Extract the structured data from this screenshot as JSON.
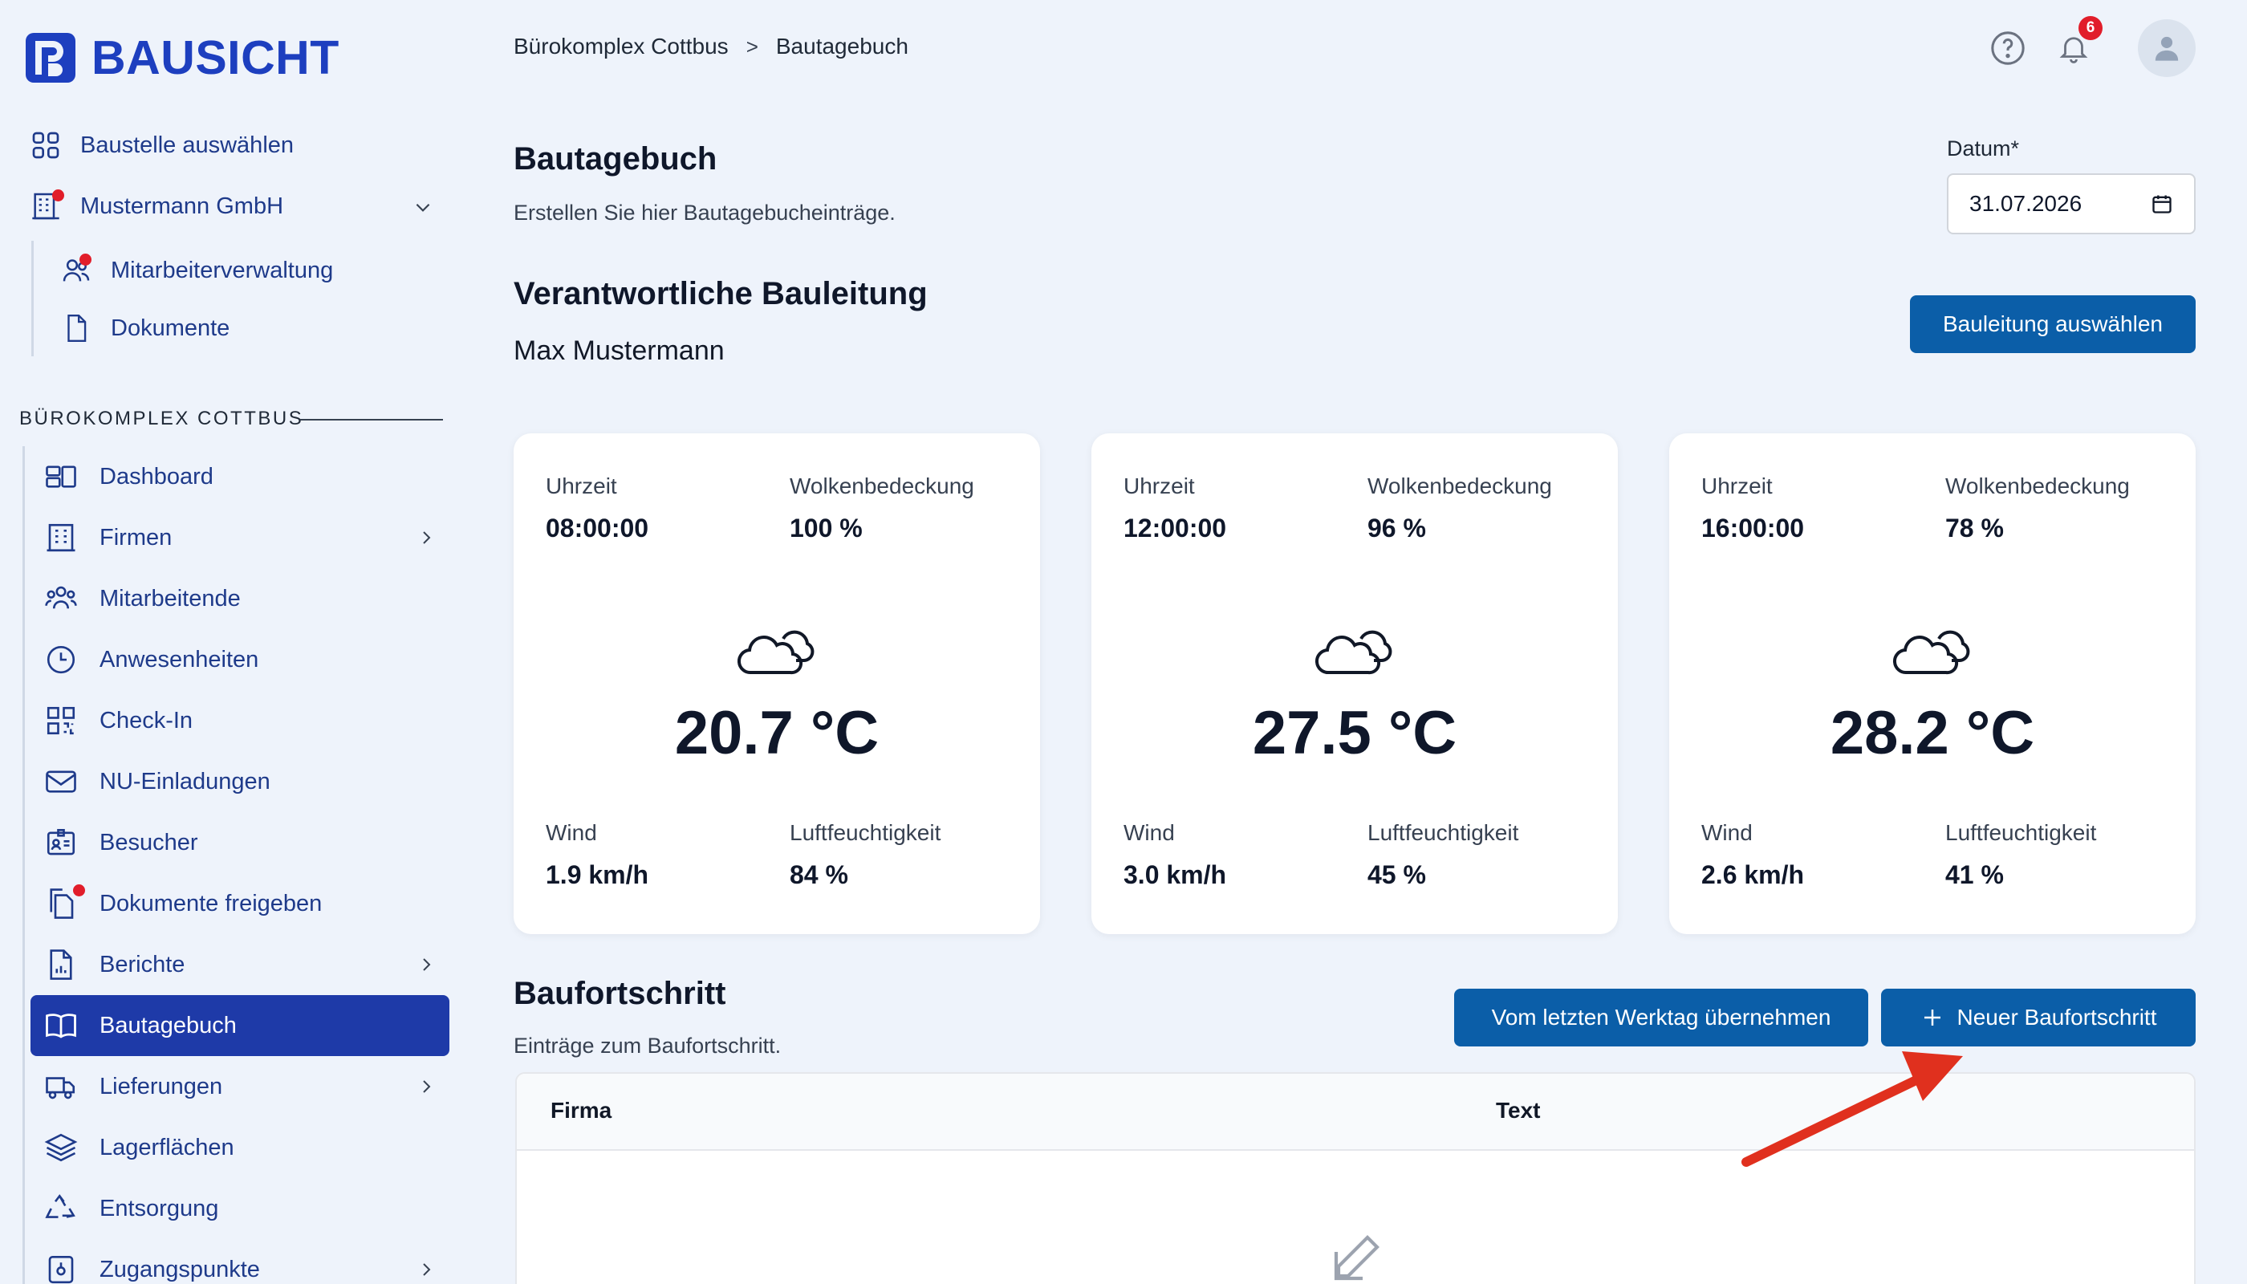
{
  "app": {
    "brand": "BAUSICHT"
  },
  "sidebar": {
    "top": [
      {
        "label": "Baustelle auswählen"
      },
      {
        "label": "Mustermann GmbH"
      }
    ],
    "company_sub": [
      {
        "label": "Mitarbeiterverwaltung"
      },
      {
        "label": "Dokumente"
      }
    ],
    "section_title": "BÜROKOMPLEX COTTBUS",
    "nav": [
      {
        "label": "Dashboard"
      },
      {
        "label": "Firmen"
      },
      {
        "label": "Mitarbeitende"
      },
      {
        "label": "Anwesenheiten"
      },
      {
        "label": "Check-In"
      },
      {
        "label": "NU-Einladungen"
      },
      {
        "label": "Besucher"
      },
      {
        "label": "Dokumente freigeben"
      },
      {
        "label": "Berichte"
      },
      {
        "label": "Bautagebuch"
      },
      {
        "label": "Lieferungen"
      },
      {
        "label": "Lagerflächen"
      },
      {
        "label": "Entsorgung"
      },
      {
        "label": "Zugangspunkte"
      }
    ],
    "active": "Bautagebuch"
  },
  "header": {
    "breadcrumb": [
      "Bürokomplex Cottbus",
      "Bautagebuch"
    ],
    "breadcrumb_sep": ">",
    "notification_count": "6"
  },
  "page": {
    "title": "Bautagebuch",
    "subtitle": "Erstellen Sie hier Bautagebucheinträge.",
    "date_label": "Datum*",
    "date_value": "31.07.2026",
    "responsible_title": "Verantwortliche Bauleitung",
    "responsible_name": "Max Mustermann",
    "select_button": "Bauleitung auswählen"
  },
  "weather": {
    "labels": {
      "time": "Uhrzeit",
      "clouds": "Wolkenbedeckung",
      "wind": "Wind",
      "humidity": "Luftfeuchtigkeit"
    },
    "cards": [
      {
        "time": "08:00:00",
        "clouds": "100 %",
        "temp": "20.7 °C",
        "wind": "1.9 km/h",
        "humidity": "84 %"
      },
      {
        "time": "12:00:00",
        "clouds": "96 %",
        "temp": "27.5 °C",
        "wind": "3.0 km/h",
        "humidity": "45 %"
      },
      {
        "time": "16:00:00",
        "clouds": "78 %",
        "temp": "28.2 °C",
        "wind": "2.6 km/h",
        "humidity": "41 %"
      }
    ]
  },
  "progress": {
    "title": "Baufortschritt",
    "subtitle": "Einträge zum Baufortschritt.",
    "copy_button": "Vom letzten Werktag übernehmen",
    "new_button": "Neuer Baufortschritt",
    "columns": [
      "Firma",
      "Text"
    ]
  },
  "colors": {
    "brand": "#1d3fbf",
    "primary_button": "#0b5ea8",
    "active_nav": "#1e3aa8",
    "alert": "#e11d2a",
    "annotation_arrow": "#e0301e"
  }
}
